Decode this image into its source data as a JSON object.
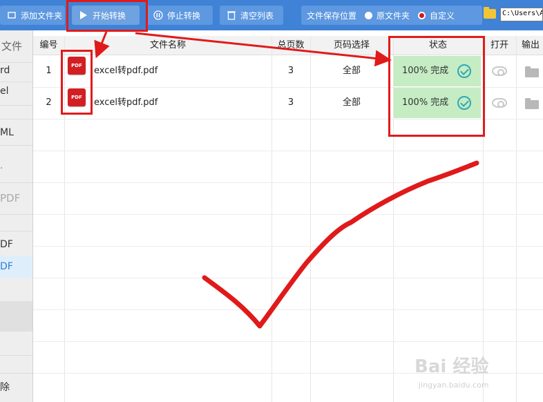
{
  "toolbar": {
    "add_folder": "添加文件夹",
    "start_convert": "开始转换",
    "stop_convert": "停止转换",
    "clear_list": "清空列表",
    "save_location_label": "文件保存位置",
    "option_original": "原文件夹",
    "option_custom": "自定义",
    "path_value": "C:\\Users\\A"
  },
  "sidebar": {
    "items": [
      "文件",
      "rd",
      "el",
      "ML",
      "·",
      "PDF",
      "DF",
      "DF",
      "除"
    ]
  },
  "table": {
    "columns": [
      "编号",
      "文件名称",
      "总页数",
      "页码选择",
      "状态",
      "打开",
      "输出"
    ],
    "rows": [
      {
        "num": "1",
        "name": "excel转pdf.pdf",
        "pages": "3",
        "range": "全部",
        "status": "100% 完成"
      },
      {
        "num": "2",
        "name": "excel转pdf.pdf",
        "pages": "3",
        "range": "全部",
        "status": "100% 完成"
      }
    ]
  },
  "icons": {
    "pdf": "PDF"
  },
  "watermark": {
    "brand": "Bai 经验",
    "url": "jingyan.baidu.com"
  },
  "colors": {
    "toolbar": "#3f82d6",
    "status_done": "#c5ecc3",
    "annotation": "#e01a1a"
  }
}
